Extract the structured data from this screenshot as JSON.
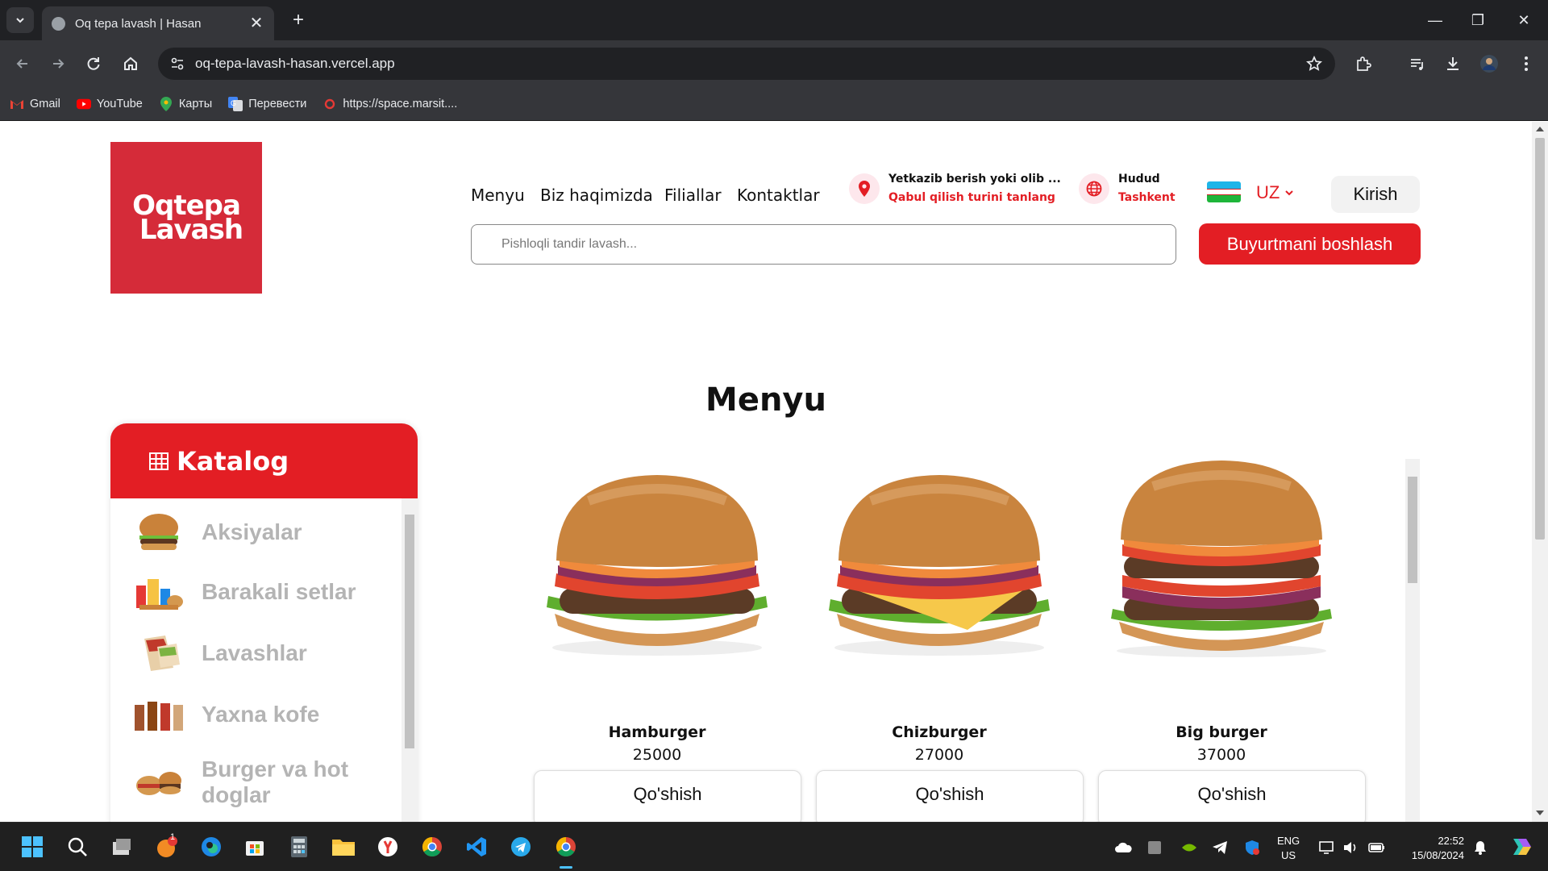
{
  "browser": {
    "tab_title": "Oq tepa lavash | Hasan",
    "url": "oq-tepa-lavash-hasan.vercel.app",
    "bookmarks": [
      {
        "label": "Gmail",
        "icon": "gmail-icon"
      },
      {
        "label": "YouTube",
        "icon": "youtube-icon"
      },
      {
        "label": "Карты",
        "icon": "maps-icon"
      },
      {
        "label": "Перевести",
        "icon": "translate-icon"
      },
      {
        "label": "https://space.marsit....",
        "icon": "marsit-icon"
      }
    ]
  },
  "header": {
    "logo_line1": "Oqtepa",
    "logo_line2": "Lavash",
    "nav": [
      "Menyu",
      "Biz haqimizda",
      "Filiallar",
      "Kontaktlar"
    ],
    "delivery": {
      "title": "Yetkazib berish yoki olib ...",
      "subtitle": "Qabul qilish turini tanlang"
    },
    "region": {
      "title": "Hudud",
      "subtitle": "Tashkent"
    },
    "language": "UZ",
    "login_label": "Kirish",
    "search_placeholder": "Pishloqli tandir lavash...",
    "order_label": "Buyurtmani boshlash"
  },
  "main": {
    "section_title": "Menyu",
    "catalog": {
      "title": "Katalog",
      "items": [
        "Aksiyalar",
        "Barakali setlar",
        "Lavashlar",
        "Yaxna kofe",
        "Burger va hot doglar"
      ]
    },
    "products": [
      {
        "name": "Hamburger",
        "price": "25000",
        "button": "Qo'shish"
      },
      {
        "name": "Chizburger",
        "price": "27000",
        "button": "Qo'shish"
      },
      {
        "name": "Big burger",
        "price": "37000",
        "button": "Qo'shish"
      }
    ]
  },
  "taskbar": {
    "language_line1": "ENG",
    "language_line2": "US",
    "time": "22:52",
    "date": "15/08/2024",
    "badge_count": "1"
  },
  "colors": {
    "brand_red": "#e31e24",
    "logo_red": "#d52b39",
    "chrome_dark": "#202124",
    "chrome_mid": "#35363a"
  }
}
